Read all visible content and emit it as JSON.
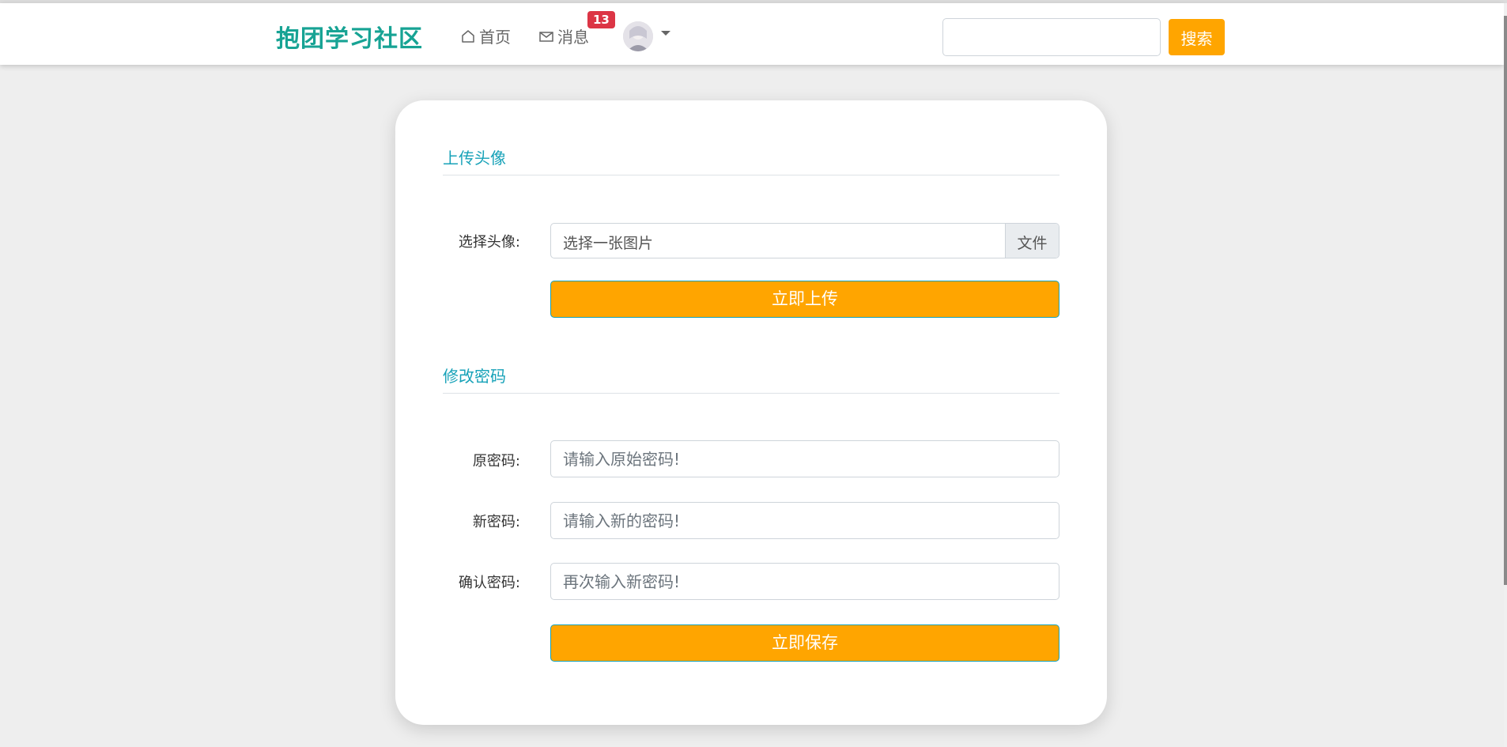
{
  "header": {
    "brand": "抱团学习社区",
    "nav_home": "首页",
    "nav_messages": "消息",
    "message_badge": "13",
    "search_placeholder": "",
    "search_button": "搜索"
  },
  "avatar_section": {
    "title": "上传头像",
    "choose_label": "选择头像:",
    "file_placeholder": "选择一张图片",
    "file_button": "文件",
    "upload_button": "立即上传"
  },
  "password_section": {
    "title": "修改密码",
    "old_label": "原密码:",
    "old_placeholder": "请输入原始密码!",
    "new_label": "新密码:",
    "new_placeholder": "请输入新的密码!",
    "confirm_label": "确认密码:",
    "confirm_placeholder": "再次输入新密码!",
    "save_button": "立即保存"
  },
  "colors": {
    "brand": "#17a394",
    "accent": "#ffa500",
    "section_title": "#17a2b8",
    "badge": "#dc3545",
    "background": "#eeeeee"
  },
  "icons": {
    "home": "home-icon",
    "messages": "envelope-icon",
    "user_menu": "caret-down-icon"
  }
}
